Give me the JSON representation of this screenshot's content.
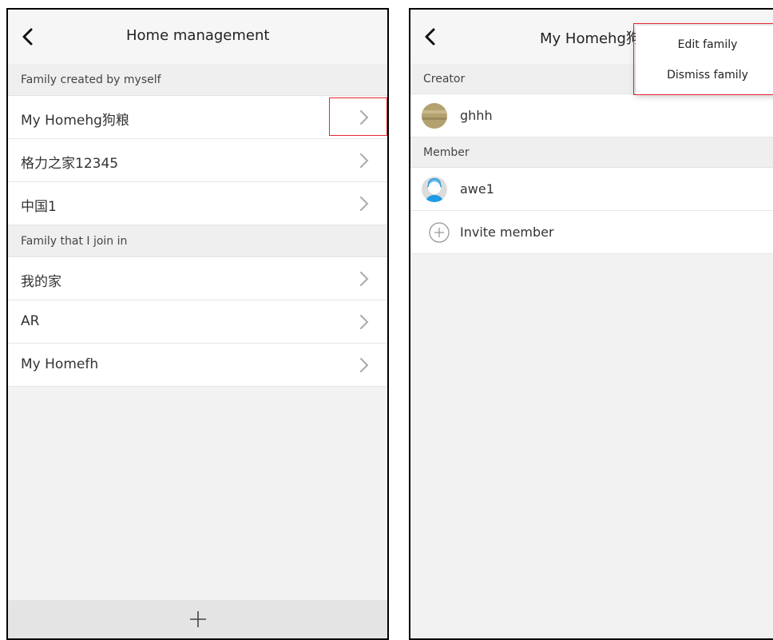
{
  "left": {
    "title": "Home management",
    "section_created": "Family created by myself",
    "created_families": [
      "My Homehg狗粮",
      "格力之家12345",
      "中国1"
    ],
    "section_joined": "Family that I join in",
    "joined_families": [
      "我的家",
      "AR",
      "My Homefh"
    ]
  },
  "right": {
    "title": "My Homehg狗",
    "section_creator": "Creator",
    "creator_name": "ghhh",
    "section_member": "Member",
    "member_name": "awe1",
    "invite_label": "Invite member",
    "menu": {
      "edit": "Edit family",
      "dismiss": "Dismiss family"
    }
  },
  "colors": {
    "highlight": "#e8262f",
    "background": "#f2f2f2"
  },
  "icons": [
    "back-icon",
    "chevron-right-icon",
    "plus-icon",
    "add-circle-icon",
    "avatar-icon"
  ]
}
